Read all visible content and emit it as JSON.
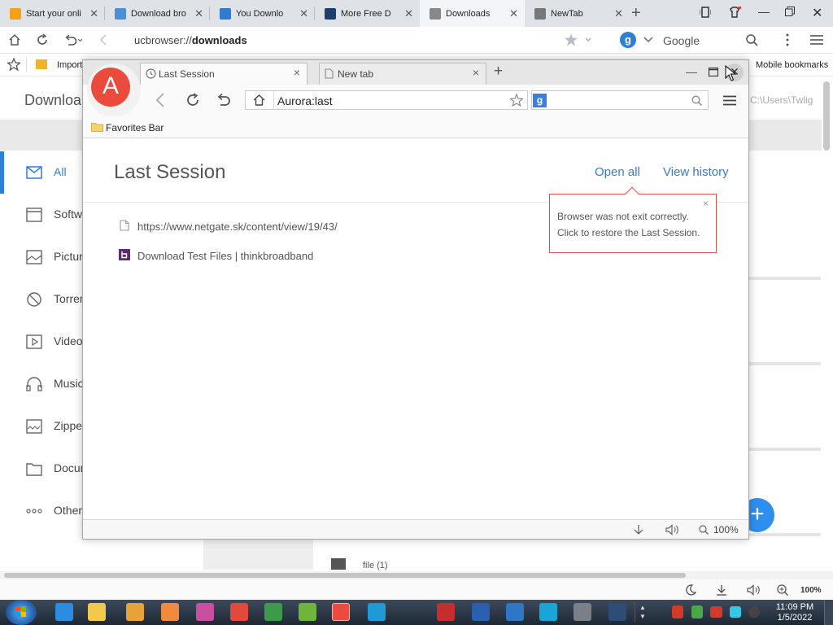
{
  "outer_tabs": [
    {
      "title": "Start your onli",
      "color": "#f4a11a",
      "active": false
    },
    {
      "title": "Download bro",
      "color": "#4d8fd6",
      "active": false
    },
    {
      "title": "You Downlo",
      "color": "#2e7bcf",
      "active": false
    },
    {
      "title": "More Free D",
      "color": "#1c3f6e",
      "active": false
    },
    {
      "title": "Downloads",
      "color": "#888888",
      "active": true
    },
    {
      "title": "NewTab",
      "color": "#777777",
      "active": false
    }
  ],
  "outer_address": {
    "prefix": "ucbrowser://",
    "bold": "downloads"
  },
  "outer_search": {
    "engine_letter": "g",
    "label": "Google"
  },
  "outer_bookmarks": {
    "import_label": "Import",
    "mobile_label": "Mobile bookmarks"
  },
  "dl_page": {
    "title": "Downloa",
    "path": "C:\\Users\\Twlig",
    "sidebar": [
      {
        "label": "All",
        "icon": "mail-icon",
        "active": true
      },
      {
        "label": "Softwa",
        "icon": "software-icon",
        "active": false
      },
      {
        "label": "Pictur",
        "icon": "picture-icon",
        "active": false
      },
      {
        "label": "Torren",
        "icon": "torrent-icon",
        "active": false
      },
      {
        "label": "Video",
        "icon": "video-icon",
        "active": false
      },
      {
        "label": "Music",
        "icon": "headphones-icon",
        "active": false
      },
      {
        "label": "Zippe",
        "icon": "zip-icon",
        "active": false
      },
      {
        "label": "Docun",
        "icon": "folder-icon",
        "active": false
      },
      {
        "label": "Other",
        "icon": "more-icon",
        "active": false
      }
    ],
    "file_item": "file (1)"
  },
  "aurora": {
    "logo_letter": "A",
    "tabs": [
      {
        "label": "Last Session",
        "active": true
      },
      {
        "label": "New tab",
        "active": false
      }
    ],
    "address": "Aurora:last",
    "search_engine_letter": "g",
    "favorites_bar": "Favorites Bar",
    "page_title": "Last Session",
    "open_all": "Open all",
    "view_history": "View history",
    "tooltip_line1": "Browser was not exit correctly.",
    "tooltip_line2": "Click to restore the Last Session.",
    "sessions": [
      {
        "text": "https://www.netgate.sk/content/view/19/43/",
        "icon": "page-icon"
      },
      {
        "text": "Download Test Files | thinkbroadband",
        "icon": "thinkbroadband-icon"
      }
    ],
    "zoom": "100%"
  },
  "outer_status": {
    "zoom": "100%"
  },
  "taskbar": {
    "time": "11:09 PM",
    "date": "1/5/2022"
  },
  "colors": {
    "accent_blue": "#2e7fd6",
    "aurora_red": "#ea4b3c",
    "tooltip_border": "#d9534f"
  }
}
